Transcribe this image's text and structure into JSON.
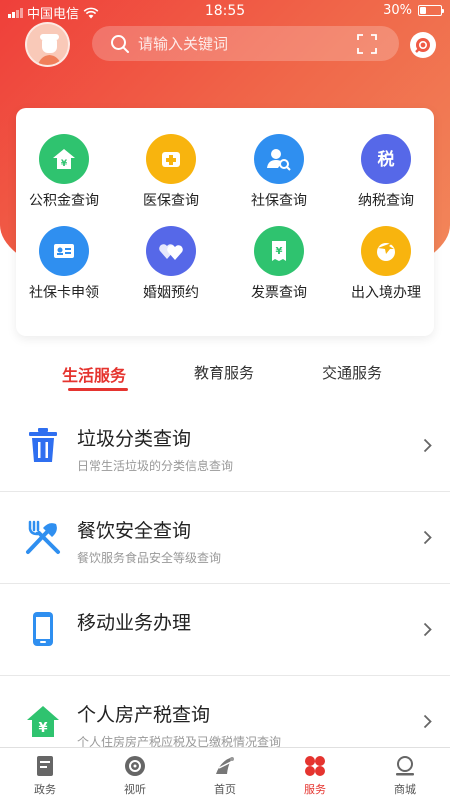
{
  "status_bar": {
    "carrier": "中国电信",
    "time": "18:55",
    "battery": "30%",
    "battery_level": 0.3
  },
  "search": {
    "placeholder": "请输入关键词"
  },
  "services_grid": [
    {
      "label": "公积金查询",
      "icon": "housing-fund-icon",
      "color": "#2fc36f"
    },
    {
      "label": "医保查询",
      "icon": "medical-insurance-icon",
      "color": "#f8b40e"
    },
    {
      "label": "社保查询",
      "icon": "social-security-search-icon",
      "color": "#2f8ff0"
    },
    {
      "label": "纳税查询",
      "icon": "tax-icon",
      "color": "#5668e8"
    },
    {
      "label": "社保卡申领",
      "icon": "id-card-icon",
      "color": "#2f8ff0"
    },
    {
      "label": "婚姻预约",
      "icon": "hearts-icon",
      "color": "#5668e8"
    },
    {
      "label": "发票查询",
      "icon": "invoice-icon",
      "color": "#2fc36f"
    },
    {
      "label": "出入境办理",
      "icon": "plane-globe-icon",
      "color": "#f8b40e"
    }
  ],
  "tabs": [
    {
      "label": "生活服务",
      "active": true
    },
    {
      "label": "教育服务",
      "active": false
    },
    {
      "label": "交通服务",
      "active": false
    }
  ],
  "list": [
    {
      "title": "垃圾分类查询",
      "subtitle": "日常生活垃圾的分类信息查询",
      "icon": "trash-bin-icon"
    },
    {
      "title": "餐饮安全查询",
      "subtitle": "餐饮服务食品安全等级查询",
      "icon": "fork-knife-icon"
    },
    {
      "title": "移动业务办理",
      "subtitle": "",
      "icon": "mobile-phone-icon"
    },
    {
      "title": "个人房产税查询",
      "subtitle": "个人住房房产税应税及已缴税情况查询",
      "icon": "house-yuan-icon"
    }
  ],
  "tabbar": [
    {
      "label": "政务",
      "icon": "document-icon",
      "active": false
    },
    {
      "label": "视听",
      "icon": "disc-icon",
      "active": false
    },
    {
      "label": "首页",
      "icon": "home-logo-icon",
      "active": false
    },
    {
      "label": "服务",
      "icon": "clover-grid-icon",
      "active": true
    },
    {
      "label": "商城",
      "icon": "shop-icon",
      "active": false
    }
  ],
  "colors": {
    "brand_red": "#e5342f",
    "blue": "#2f8ff0",
    "green": "#2fc36f"
  }
}
